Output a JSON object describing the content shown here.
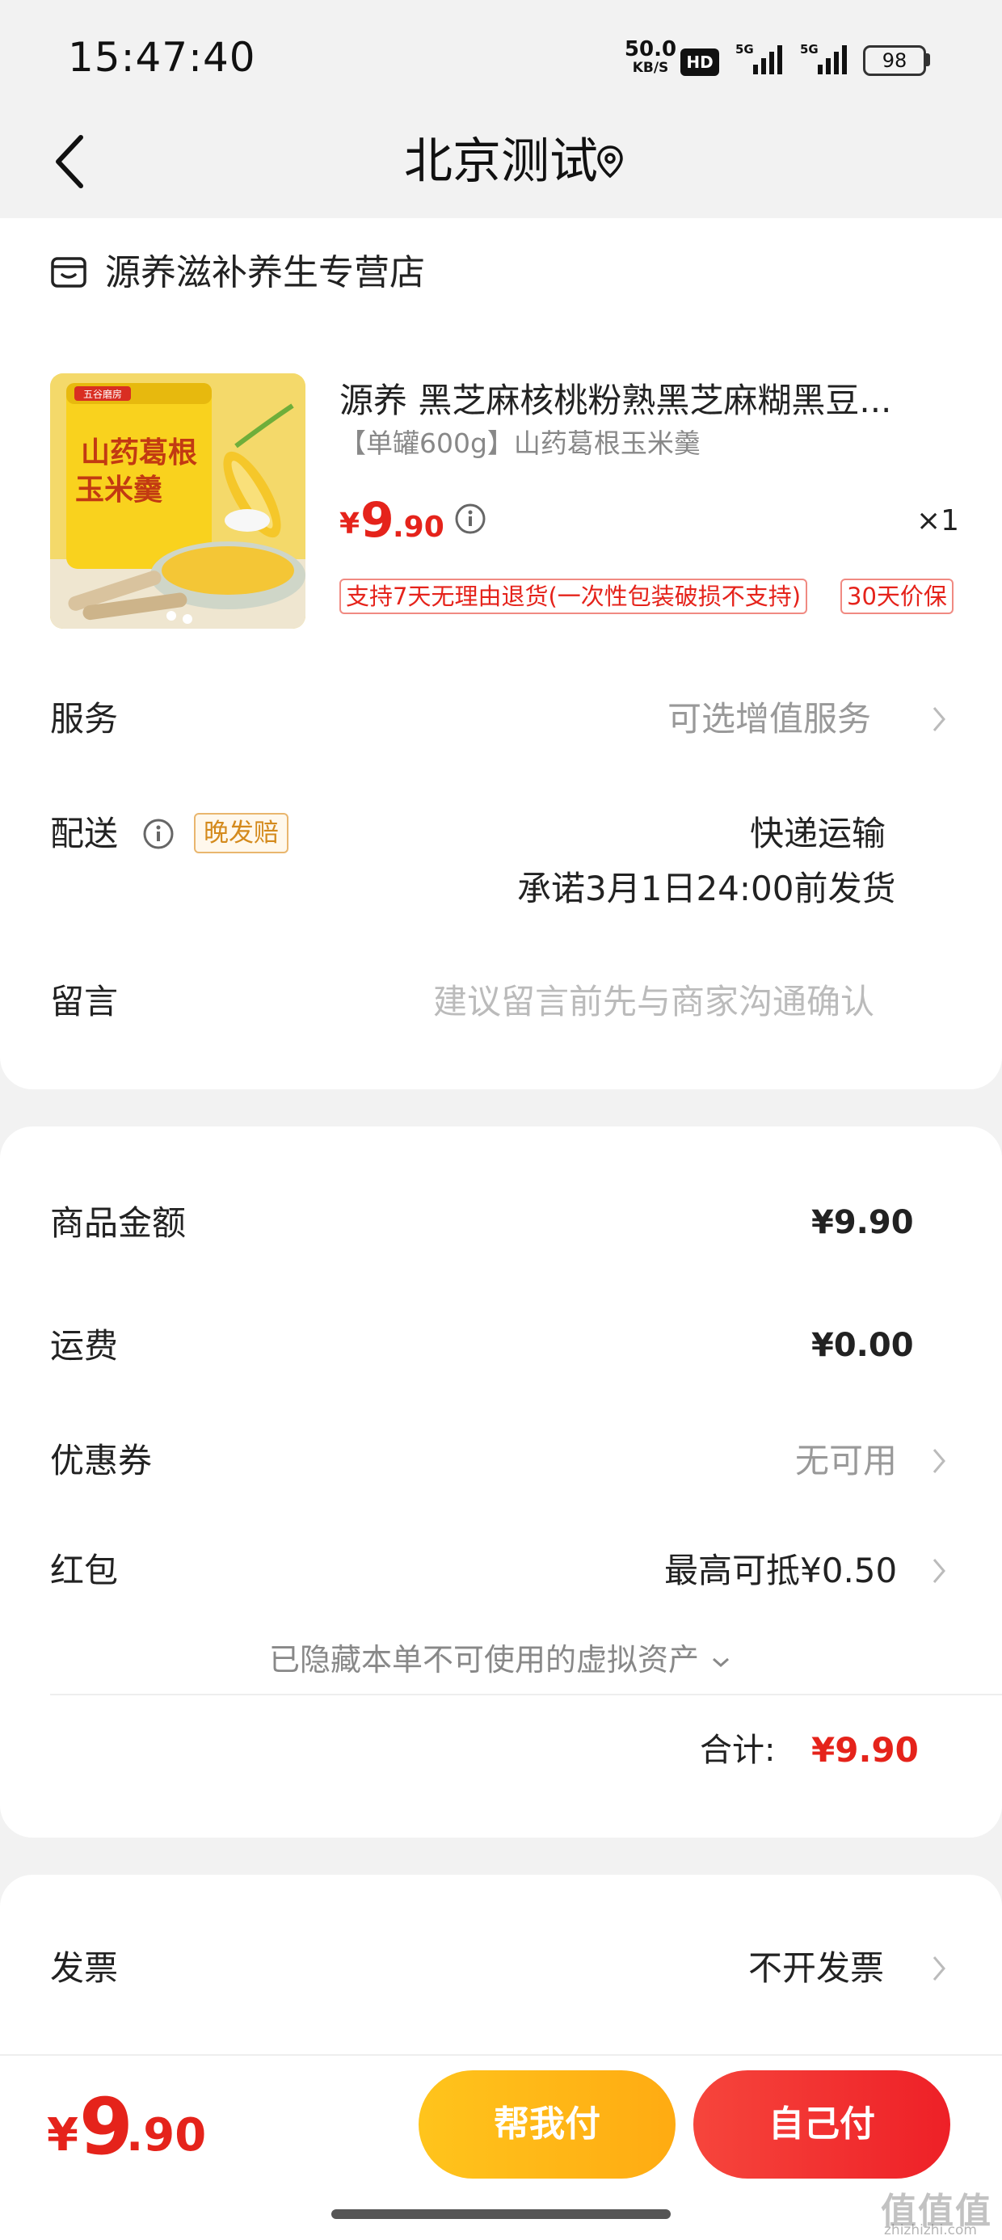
{
  "status_bar": {
    "time": "15:47:40",
    "net_speed_value": "50.0",
    "net_speed_unit": "KB/S",
    "hd_badge": "HD",
    "signal_1_label": "5G",
    "signal_2_label": "5G",
    "battery": "98"
  },
  "header": {
    "title": "北京测试",
    "back_icon": "chevron-left-icon",
    "location_icon": "location-pin-icon"
  },
  "store": {
    "icon": "store-icon",
    "name": "源养滋补养生专营店"
  },
  "product": {
    "title": "源养 黑芝麻核桃粉熟黑芝麻糊黑豆...",
    "spec": "【单罐600g】山药葛根玉米羹",
    "price_yen": "¥",
    "price_int": "9",
    "price_dec": ".90",
    "quantity": "×1",
    "tags": [
      "支持7天无理由退货(一次性包装破损不支持)",
      "30天价保"
    ],
    "image_text_1": "山药葛根",
    "image_text_2": "玉米羹",
    "image_brand": "五谷磨房"
  },
  "rows": {
    "service_label": "服务",
    "service_value": "可选增值服务",
    "delivery_label": "配送",
    "delivery_badge": "晚发赔",
    "delivery_method": "快递运输",
    "delivery_promise": "承诺3月1日24:00前发货",
    "message_label": "留言",
    "message_placeholder": "建议留言前先与商家沟通确认"
  },
  "pricing": {
    "goods_amount_label": "商品金额",
    "goods_amount_value": "¥9.90",
    "shipping_label": "运费",
    "shipping_value": "¥0.00",
    "coupon_label": "优惠券",
    "coupon_value": "无可用",
    "redpacket_label": "红包",
    "redpacket_value": "最高可抵¥0.50",
    "hidden_assets_text": "已隐藏本单不可使用的虚拟资产",
    "total_label": "合计:",
    "total_value": "¥9.90"
  },
  "invoice": {
    "label": "发票",
    "value": "不开发票"
  },
  "bottom": {
    "price_yen": "¥",
    "price_int": "9",
    "price_dec": ".90",
    "help_pay_label": "帮我付",
    "self_pay_label": "自己付"
  },
  "watermark": {
    "text": "值值值",
    "url": "zhizhizhi.com"
  },
  "colors": {
    "accent_red": "#e5231b",
    "help_button": "#ffb816",
    "self_button": "#f0302e"
  }
}
